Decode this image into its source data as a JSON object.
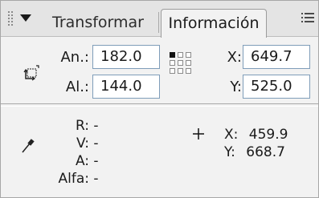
{
  "tabs": [
    {
      "label": "Transformar",
      "active": false
    },
    {
      "label": "Información",
      "active": true
    }
  ],
  "size": {
    "width_label": "An.:",
    "width_value": "182.0",
    "height_label": "Al.:",
    "height_value": "144.0"
  },
  "position": {
    "x_label": "X:",
    "x_value": "649.7",
    "y_label": "Y:",
    "y_value": "525.0"
  },
  "color_info": {
    "r_label": "R:",
    "r_value": "-",
    "g_label": "V:",
    "g_value": "-",
    "b_label": "A:",
    "b_value": "-",
    "alpha_label": "Alfa:",
    "alpha_value": "-"
  },
  "cursor": {
    "x_label": "X:",
    "x_value": "459.9",
    "y_label": "Y:",
    "y_value": "668.7"
  },
  "icons": {
    "grip": "grip-dots-icon",
    "collapse": "triangle-down-icon",
    "menu": "panel-menu-icon",
    "resize": "resize-icon",
    "registration": "registration-grid-icon",
    "eyedropper": "eyedropper-icon",
    "crosshair": "crosshair-icon"
  },
  "colors": {
    "panel_bg": "#f2f2f2",
    "tab_strip_bg": "#e4e4e4",
    "field_border": "#7f9db9"
  }
}
